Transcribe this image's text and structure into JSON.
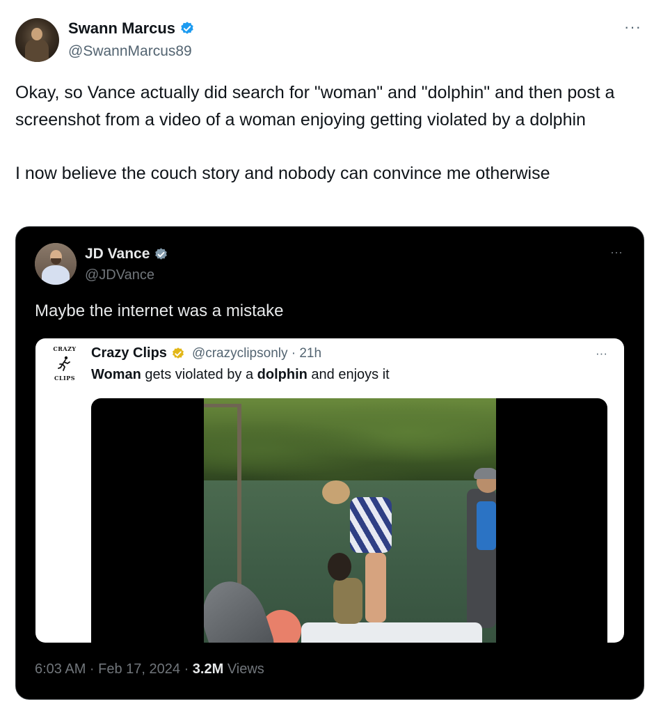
{
  "tweet": {
    "author_name": "Swann Marcus",
    "author_handle": "@SwannMarcus89",
    "more": "···",
    "text_line1": "Okay, so Vance actually did search for \"woman\" and \"dolphin\" and then post a screenshot from a video of a woman enjoying getting violated by a dolphin",
    "text_line2": "I now believe the couch story and nobody can convince me otherwise"
  },
  "quoted": {
    "author_name": "JD Vance",
    "author_handle": "@JDVance",
    "more": "···",
    "text": "Maybe the internet was a mistake",
    "inner": {
      "logo_top": "CRAZY",
      "logo_bottom": "CLIPS",
      "author_name": "Crazy Clips",
      "author_handle": "@crazyclipsonly · 21h",
      "more": "···",
      "text_word1": "Woman",
      "text_mid": " gets violated by a ",
      "text_word2": "dolphin",
      "text_end": " and enjoys it"
    },
    "time": "6:03 AM · Feb 17, 2024 · ",
    "views_count": "3.2M",
    "views_label": " Views"
  },
  "colors": {
    "verified_blue": "#1d9bf0",
    "verified_gold": "#e2b719",
    "verified_gray": "#829aab"
  }
}
